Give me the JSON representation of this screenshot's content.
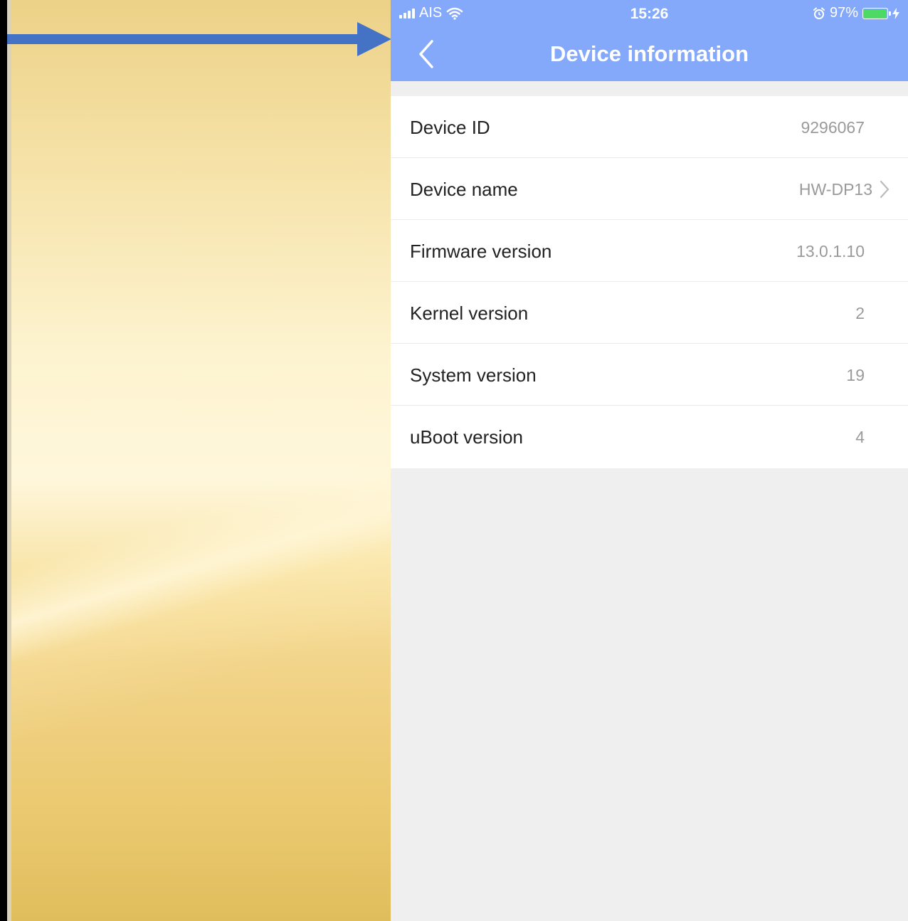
{
  "status_bar": {
    "carrier": "AIS",
    "time": "15:26",
    "battery_percent": "97%",
    "battery_level": 0.97
  },
  "nav": {
    "title": "Device information"
  },
  "rows": [
    {
      "label": "Device ID",
      "value": "9296067"
    },
    {
      "label": "Device name",
      "value": "HW-DP13"
    },
    {
      "label": "Firmware version",
      "value": "13.0.1.10"
    },
    {
      "label": "Kernel version",
      "value": "2"
    },
    {
      "label": "System version",
      "value": "19"
    },
    {
      "label": "uBoot version",
      "value": "4"
    }
  ],
  "colors": {
    "nav_background": "#85a9fa",
    "arrow": "#4472c4",
    "battery_fill": "#4cd964"
  }
}
